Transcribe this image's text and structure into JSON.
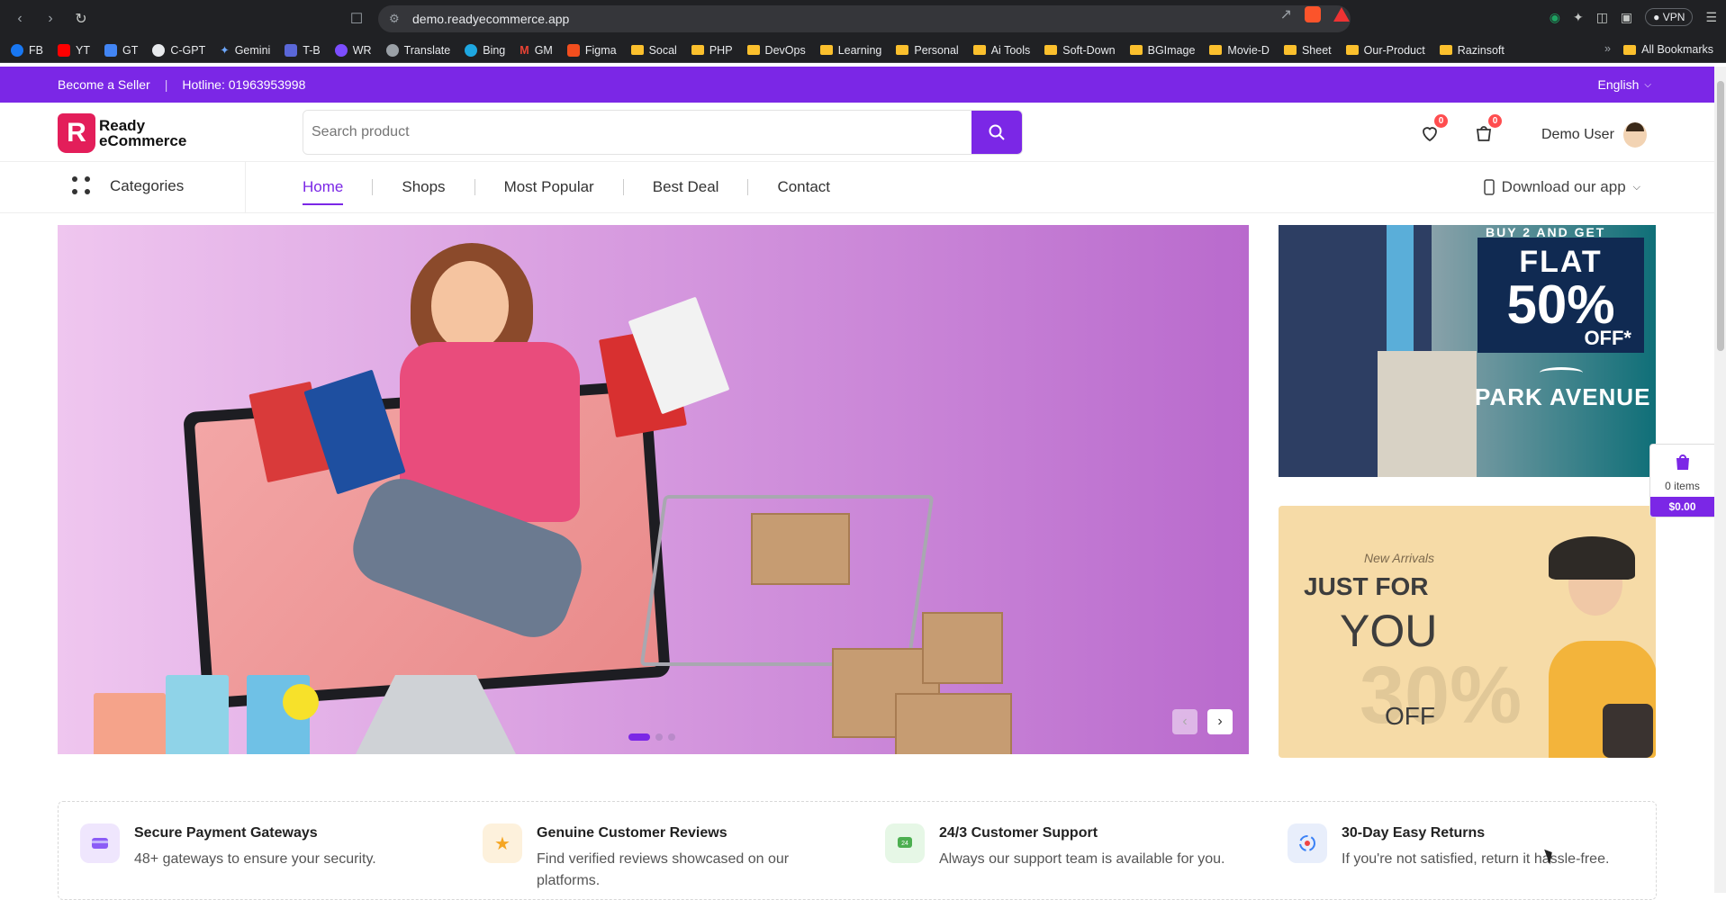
{
  "browser": {
    "url": "demo.readyecommerce.app",
    "vpn_label": "VPN",
    "bookmarks": [
      "FB",
      "YT",
      "GT",
      "C-GPT",
      "Gemini",
      "T-B",
      "WR",
      "Translate",
      "Bing",
      "GM",
      "Figma",
      "Socal",
      "PHP",
      "DevOps",
      "Learning",
      "Personal",
      "Ai Tools",
      "Soft-Down",
      "BGImage",
      "Movie-D",
      "Sheet",
      "Our-Product",
      "Razinsoft"
    ],
    "all_bookmarks": "All Bookmarks"
  },
  "topbar": {
    "become_seller": "Become a Seller",
    "hotline": "Hotline: 01963953998",
    "language": "English"
  },
  "header": {
    "logo_line1": "Ready",
    "logo_line2": "eCommerce",
    "search_placeholder": "Search product",
    "wishlist_count": "0",
    "cart_count": "0",
    "user_name": "Demo User"
  },
  "nav": {
    "categories": "Categories",
    "items": [
      "Home",
      "Shops",
      "Most Popular",
      "Best Deal",
      "Contact"
    ],
    "download_app": "Download our app"
  },
  "banner_right_top": {
    "top_line": "BUY 2 AND GET",
    "flat": "FLAT",
    "percent": "50%",
    "off": "OFF*",
    "brand": "PARK AVENUE"
  },
  "banner_right_bottom": {
    "new_arrivals": "New Arrivals",
    "just_for": "JUST FOR",
    "you": "YOU",
    "percent": "30%",
    "off": "OFF"
  },
  "float_cart": {
    "items": "0 items",
    "total": "$0.00"
  },
  "features": [
    {
      "title": "Secure Payment Gateways",
      "desc": "48+ gateways to ensure your security.",
      "color": "#efe6fd"
    },
    {
      "title": "Genuine Customer Reviews",
      "desc": "Find verified reviews showcased on our platforms.",
      "color": "#fdf1dc"
    },
    {
      "title": "24/3 Customer Support",
      "desc": "Always our support team is available for you.",
      "color": "#e6f7e6"
    },
    {
      "title": "30-Day Easy Returns",
      "desc": "If you're not satisfied, return it hassle-free.",
      "color": "#e8eefb"
    }
  ],
  "colors": {
    "brand": "#7b27e6",
    "logo_red": "#e31e5a"
  }
}
